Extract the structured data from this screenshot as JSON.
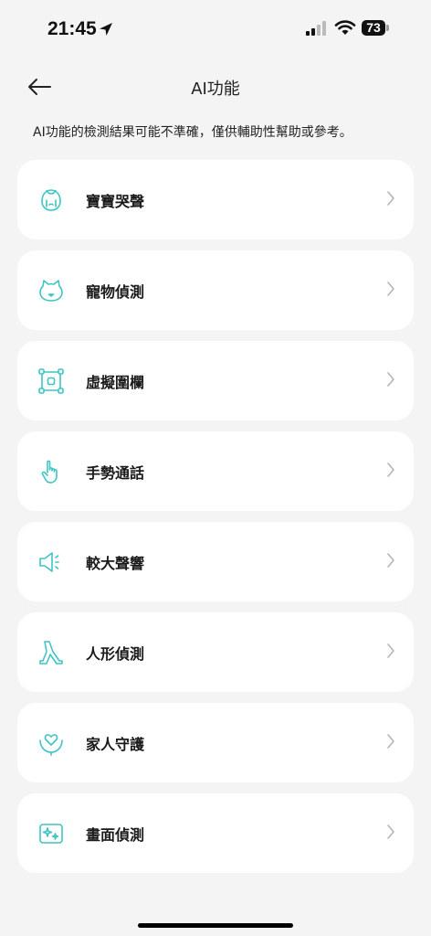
{
  "status_bar": {
    "time": "21:45",
    "battery_level": "73",
    "icons": [
      "location-arrow-icon",
      "signal-icon",
      "wifi-icon",
      "battery-icon"
    ]
  },
  "header": {
    "back_icon": "arrow-left-icon",
    "title": "AI功能"
  },
  "disclaimer": "AI功能的檢測結果可能不準確，僅供輔助性幫助或參考。",
  "accent_color": "#3fc4c4",
  "features": [
    {
      "label": "寶寶哭聲",
      "icon": "baby-cry-icon"
    },
    {
      "label": "寵物偵測",
      "icon": "pet-icon"
    },
    {
      "label": "虛擬圍欄",
      "icon": "virtual-fence-icon"
    },
    {
      "label": "手勢通話",
      "icon": "hand-gesture-icon"
    },
    {
      "label": "較大聲響",
      "icon": "loud-sound-icon"
    },
    {
      "label": "人形偵測",
      "icon": "person-detection-icon"
    },
    {
      "label": "家人守護",
      "icon": "family-guard-icon"
    },
    {
      "label": "畫面偵測",
      "icon": "scene-detection-icon"
    }
  ]
}
